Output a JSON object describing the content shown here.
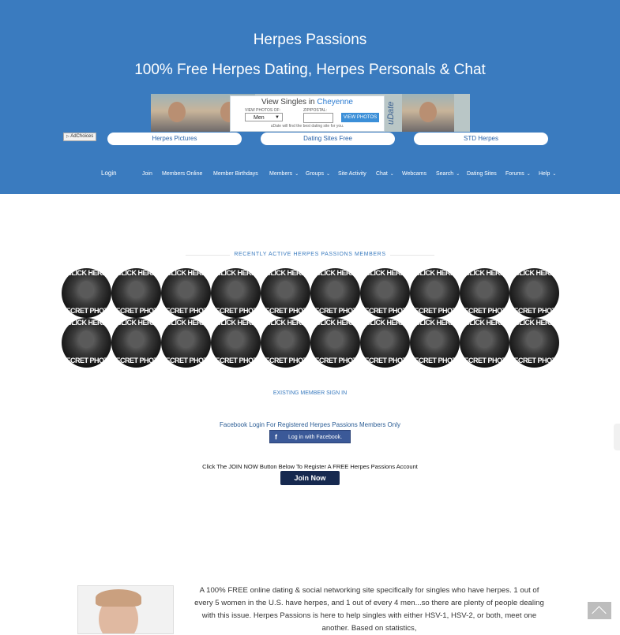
{
  "site": {
    "title": "Herpes Passions",
    "tagline": "100% Free Herpes Dating, Herpes Personals & Chat"
  },
  "ad": {
    "title_prefix": "View Singles in",
    "city": "Cheyenne",
    "photos_label": "VIEW PHOTOS OF:",
    "zip_label": "ZIP/POSTAL:",
    "select_value": "Men",
    "button": "VIEW PHOTOS",
    "footer": "uDate will find the best dating site for you.",
    "logo": "uDate"
  },
  "adchoices": "AdChoices",
  "ext_links": [
    "Herpes Pictures",
    "Dating Sites Free",
    "STD Herpes"
  ],
  "nav": {
    "login": "Login",
    "items": [
      {
        "label": "Join",
        "caret": ""
      },
      {
        "label": "Members Online",
        "caret": ""
      },
      {
        "label": "Member Birthdays",
        "caret": ""
      },
      {
        "label": "Members",
        "caret": "⌄"
      },
      {
        "label": "Groups",
        "caret": "⌄"
      },
      {
        "label": "Site Activity",
        "caret": ""
      },
      {
        "label": "Chat",
        "caret": "⌄"
      },
      {
        "label": "Webcams",
        "caret": ""
      },
      {
        "label": "Search",
        "caret": "⌄"
      },
      {
        "label": "Dating Sites",
        "caret": ""
      },
      {
        "label": "Forums",
        "caret": "⌄"
      },
      {
        "label": "Help",
        "caret": "⌄"
      }
    ]
  },
  "members": {
    "heading": "RECENTLY ACTIVE HERPES PASSIONS MEMBERS",
    "photo_top": "CLICK HERE",
    "photo_bottom": "SECRET PHOTO"
  },
  "signin": {
    "link": "EXISTING MEMBER SIGN IN",
    "fb_text": "Facebook Login For Registered Herpes Passions Members Only",
    "fb_button": "Log in with Facebook."
  },
  "join": {
    "text": "Click The JOIN NOW Button Below To Register A FREE Herpes Passions Account",
    "button": "Join Now"
  },
  "intro": {
    "text": "A 100% FREE online dating & social networking site specifically for singles who have herpes. 1 out of every 5 women in the U.S. have herpes, and 1 out of every 4 men...so there are plenty of people dealing with this issue. Herpes Passions is here to help singles with either HSV-1, HSV-2, or both, meet one another. Based on statistics,"
  },
  "colors": {
    "header_bg": "#3a7bbf",
    "accent": "#3a7bbf",
    "facebook": "#3b5998",
    "join_button": "#16294f"
  }
}
